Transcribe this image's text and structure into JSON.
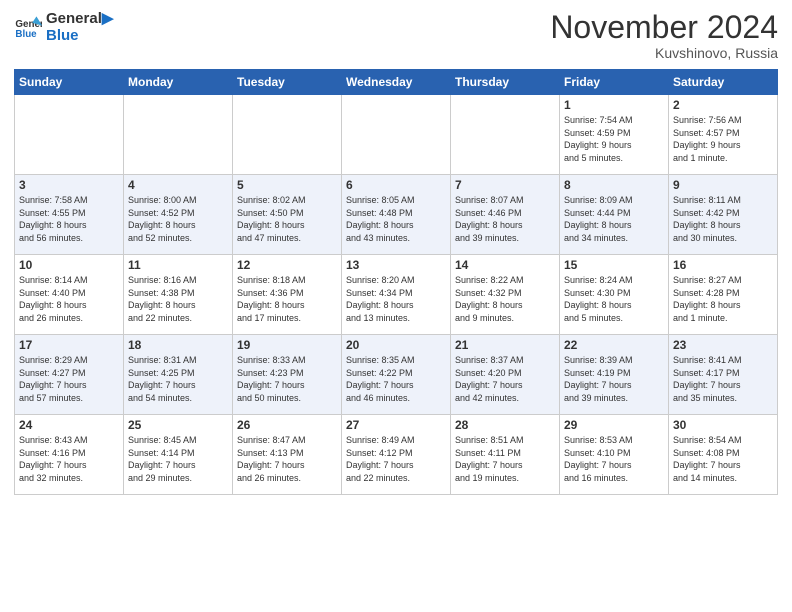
{
  "header": {
    "logo_line1": "General",
    "logo_line2": "Blue",
    "month_title": "November 2024",
    "subtitle": "Kuvshinovo, Russia"
  },
  "days_of_week": [
    "Sunday",
    "Monday",
    "Tuesday",
    "Wednesday",
    "Thursday",
    "Friday",
    "Saturday"
  ],
  "weeks": [
    [
      {
        "day": "",
        "info": ""
      },
      {
        "day": "",
        "info": ""
      },
      {
        "day": "",
        "info": ""
      },
      {
        "day": "",
        "info": ""
      },
      {
        "day": "",
        "info": ""
      },
      {
        "day": "1",
        "info": "Sunrise: 7:54 AM\nSunset: 4:59 PM\nDaylight: 9 hours\nand 5 minutes."
      },
      {
        "day": "2",
        "info": "Sunrise: 7:56 AM\nSunset: 4:57 PM\nDaylight: 9 hours\nand 1 minute."
      }
    ],
    [
      {
        "day": "3",
        "info": "Sunrise: 7:58 AM\nSunset: 4:55 PM\nDaylight: 8 hours\nand 56 minutes."
      },
      {
        "day": "4",
        "info": "Sunrise: 8:00 AM\nSunset: 4:52 PM\nDaylight: 8 hours\nand 52 minutes."
      },
      {
        "day": "5",
        "info": "Sunrise: 8:02 AM\nSunset: 4:50 PM\nDaylight: 8 hours\nand 47 minutes."
      },
      {
        "day": "6",
        "info": "Sunrise: 8:05 AM\nSunset: 4:48 PM\nDaylight: 8 hours\nand 43 minutes."
      },
      {
        "day": "7",
        "info": "Sunrise: 8:07 AM\nSunset: 4:46 PM\nDaylight: 8 hours\nand 39 minutes."
      },
      {
        "day": "8",
        "info": "Sunrise: 8:09 AM\nSunset: 4:44 PM\nDaylight: 8 hours\nand 34 minutes."
      },
      {
        "day": "9",
        "info": "Sunrise: 8:11 AM\nSunset: 4:42 PM\nDaylight: 8 hours\nand 30 minutes."
      }
    ],
    [
      {
        "day": "10",
        "info": "Sunrise: 8:14 AM\nSunset: 4:40 PM\nDaylight: 8 hours\nand 26 minutes."
      },
      {
        "day": "11",
        "info": "Sunrise: 8:16 AM\nSunset: 4:38 PM\nDaylight: 8 hours\nand 22 minutes."
      },
      {
        "day": "12",
        "info": "Sunrise: 8:18 AM\nSunset: 4:36 PM\nDaylight: 8 hours\nand 17 minutes."
      },
      {
        "day": "13",
        "info": "Sunrise: 8:20 AM\nSunset: 4:34 PM\nDaylight: 8 hours\nand 13 minutes."
      },
      {
        "day": "14",
        "info": "Sunrise: 8:22 AM\nSunset: 4:32 PM\nDaylight: 8 hours\nand 9 minutes."
      },
      {
        "day": "15",
        "info": "Sunrise: 8:24 AM\nSunset: 4:30 PM\nDaylight: 8 hours\nand 5 minutes."
      },
      {
        "day": "16",
        "info": "Sunrise: 8:27 AM\nSunset: 4:28 PM\nDaylight: 8 hours\nand 1 minute."
      }
    ],
    [
      {
        "day": "17",
        "info": "Sunrise: 8:29 AM\nSunset: 4:27 PM\nDaylight: 7 hours\nand 57 minutes."
      },
      {
        "day": "18",
        "info": "Sunrise: 8:31 AM\nSunset: 4:25 PM\nDaylight: 7 hours\nand 54 minutes."
      },
      {
        "day": "19",
        "info": "Sunrise: 8:33 AM\nSunset: 4:23 PM\nDaylight: 7 hours\nand 50 minutes."
      },
      {
        "day": "20",
        "info": "Sunrise: 8:35 AM\nSunset: 4:22 PM\nDaylight: 7 hours\nand 46 minutes."
      },
      {
        "day": "21",
        "info": "Sunrise: 8:37 AM\nSunset: 4:20 PM\nDaylight: 7 hours\nand 42 minutes."
      },
      {
        "day": "22",
        "info": "Sunrise: 8:39 AM\nSunset: 4:19 PM\nDaylight: 7 hours\nand 39 minutes."
      },
      {
        "day": "23",
        "info": "Sunrise: 8:41 AM\nSunset: 4:17 PM\nDaylight: 7 hours\nand 35 minutes."
      }
    ],
    [
      {
        "day": "24",
        "info": "Sunrise: 8:43 AM\nSunset: 4:16 PM\nDaylight: 7 hours\nand 32 minutes."
      },
      {
        "day": "25",
        "info": "Sunrise: 8:45 AM\nSunset: 4:14 PM\nDaylight: 7 hours\nand 29 minutes."
      },
      {
        "day": "26",
        "info": "Sunrise: 8:47 AM\nSunset: 4:13 PM\nDaylight: 7 hours\nand 26 minutes."
      },
      {
        "day": "27",
        "info": "Sunrise: 8:49 AM\nSunset: 4:12 PM\nDaylight: 7 hours\nand 22 minutes."
      },
      {
        "day": "28",
        "info": "Sunrise: 8:51 AM\nSunset: 4:11 PM\nDaylight: 7 hours\nand 19 minutes."
      },
      {
        "day": "29",
        "info": "Sunrise: 8:53 AM\nSunset: 4:10 PM\nDaylight: 7 hours\nand 16 minutes."
      },
      {
        "day": "30",
        "info": "Sunrise: 8:54 AM\nSunset: 4:08 PM\nDaylight: 7 hours\nand 14 minutes."
      }
    ]
  ]
}
